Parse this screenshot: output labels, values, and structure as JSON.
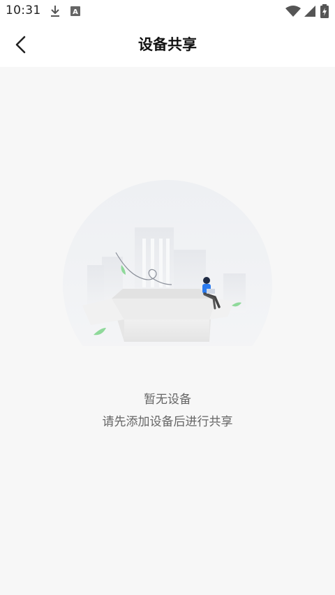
{
  "status_bar": {
    "time": "10:31",
    "icons": [
      "download-icon",
      "font-a-icon",
      "wifi-icon",
      "signal-icon",
      "battery-icon"
    ]
  },
  "header": {
    "title": "设备共享",
    "back_icon": "chevron-left-icon"
  },
  "empty_state": {
    "title": "暂无设备",
    "description": "请先添加设备后进行共享",
    "illustration": "empty-box-with-person"
  },
  "colors": {
    "page_background": "#f7f7f7",
    "header_background": "#ffffff",
    "title_text": "#111111",
    "secondary_text": "#666666",
    "person_shirt": "#2b7bf0",
    "leaf_green": "#8fd99a"
  }
}
